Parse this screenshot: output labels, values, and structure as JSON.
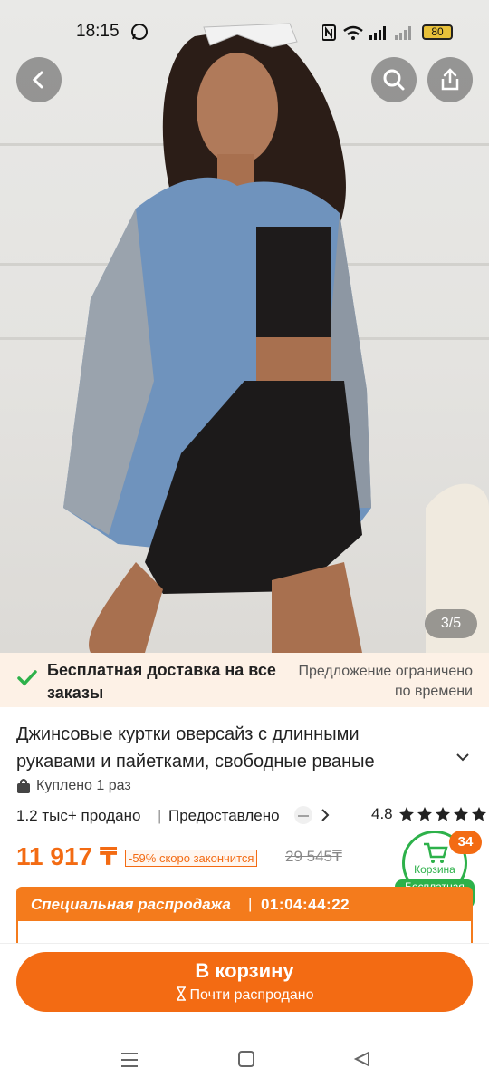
{
  "status_bar": {
    "time": "18:15",
    "battery": "80",
    "icons": [
      "whatsapp-icon",
      "nfc-icon",
      "wifi-icon",
      "signal-icon",
      "signal-icon",
      "battery-icon"
    ]
  },
  "gallery": {
    "counter": "3/5",
    "back_icon": "chevron-left-icon",
    "search_icon": "search-icon",
    "share_icon": "share-icon"
  },
  "delivery": {
    "text": "Бесплатная доставка на все заказы",
    "limited": "Предложение ограничено по времени"
  },
  "product": {
    "title": "Джинсовые куртки оверсайз с длинными рукавами и пайетками, свободные рваные",
    "bought": "Куплено 1 раз",
    "sold": "1.2 тыс+ продано",
    "provided": "Предоставлено",
    "rating": "4.8",
    "stars_filled": 5,
    "price": "11 917 ₸",
    "discount": "-59% скоро закончится",
    "old_price": "29 545₸"
  },
  "cart_badge": {
    "count": "34",
    "label": "Корзина",
    "free_delivery": "Бесплатная доставка"
  },
  "sale": {
    "label": "Специальная распродажа",
    "separator": "|",
    "timer": "01:04:44:22"
  },
  "bottom": {
    "cart_button": "В корзину",
    "almost_sold": "Почти распродано"
  },
  "colors": {
    "accent": "#f36b13",
    "green": "#2db14a",
    "delivery_bg": "#fdf1e6"
  }
}
